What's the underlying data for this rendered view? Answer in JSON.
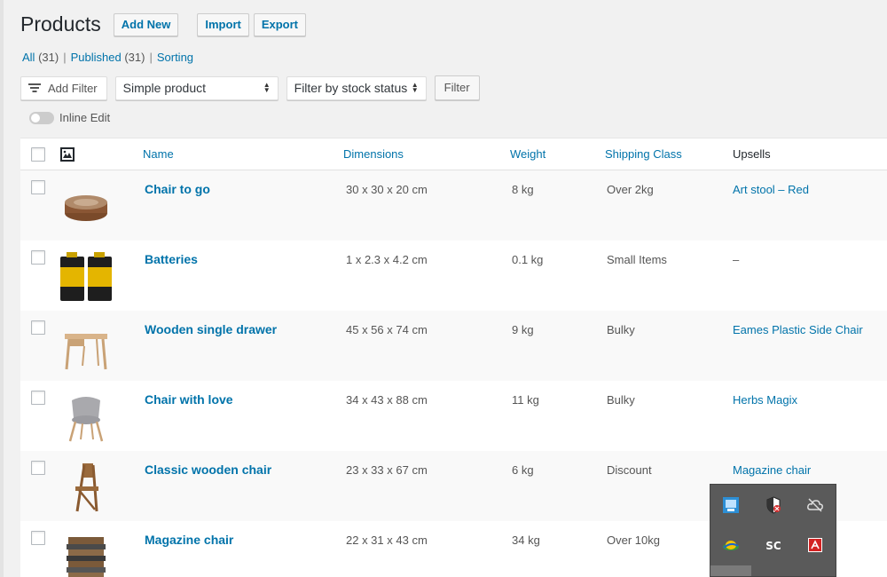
{
  "header": {
    "title": "Products",
    "add_new": "Add New",
    "import": "Import",
    "export": "Export"
  },
  "views": {
    "all_label": "All",
    "all_count": "(31)",
    "published_label": "Published",
    "published_count": "(31)",
    "sorting_label": "Sorting",
    "separator": "|"
  },
  "filters": {
    "add_filter": "Add Filter",
    "product_type_selected": "Simple product",
    "stock_status_selected": "Filter by stock status",
    "filter_button": "Filter"
  },
  "inline_edit": {
    "label": "Inline Edit",
    "enabled": false
  },
  "table": {
    "columns": {
      "name": "Name",
      "dimensions": "Dimensions",
      "weight": "Weight",
      "shipping_class": "Shipping Class",
      "upsells": "Upsells"
    },
    "rows": [
      {
        "name": "Chair to go",
        "dimensions": "30 x 30 x 20 cm",
        "weight": "8 kg",
        "shipping_class": "Over 2kg",
        "upsells": "Art stool – Red",
        "thumb_icon": "round-pouf-thumbnail"
      },
      {
        "name": "Batteries",
        "dimensions": "1 x 2.3 x 4.2 cm",
        "weight": "0.1 kg",
        "shipping_class": "Small Items",
        "upsells": "–",
        "thumb_icon": "batteries-thumbnail"
      },
      {
        "name": "Wooden single drawer",
        "dimensions": "45 x 56 x 74 cm",
        "weight": "9 kg",
        "shipping_class": "Bulky",
        "upsells": "Eames Plastic Side Chair",
        "thumb_icon": "wooden-desk-thumbnail"
      },
      {
        "name": "Chair with love",
        "dimensions": "34 x 43 x 88 cm",
        "weight": "11 kg",
        "shipping_class": "Bulky",
        "upsells": "Herbs Magix",
        "thumb_icon": "grey-chair-thumbnail"
      },
      {
        "name": "Classic wooden chair",
        "dimensions": "23 x 33 x 67 cm",
        "weight": "6 kg",
        "shipping_class": "Discount",
        "upsells": "Magazine chair",
        "thumb_icon": "folding-chair-thumbnail"
      },
      {
        "name": "Magazine chair",
        "dimensions": "22 x 31 x 43 cm",
        "weight": "34 kg",
        "shipping_class": "Over 10kg",
        "upsells": "",
        "thumb_icon": "magazine-chair-thumbnail"
      }
    ]
  },
  "colors": {
    "link": "#0073aa",
    "text": "#555555",
    "background": "#f1f1f1",
    "tray_background": "#5a5a5a"
  }
}
